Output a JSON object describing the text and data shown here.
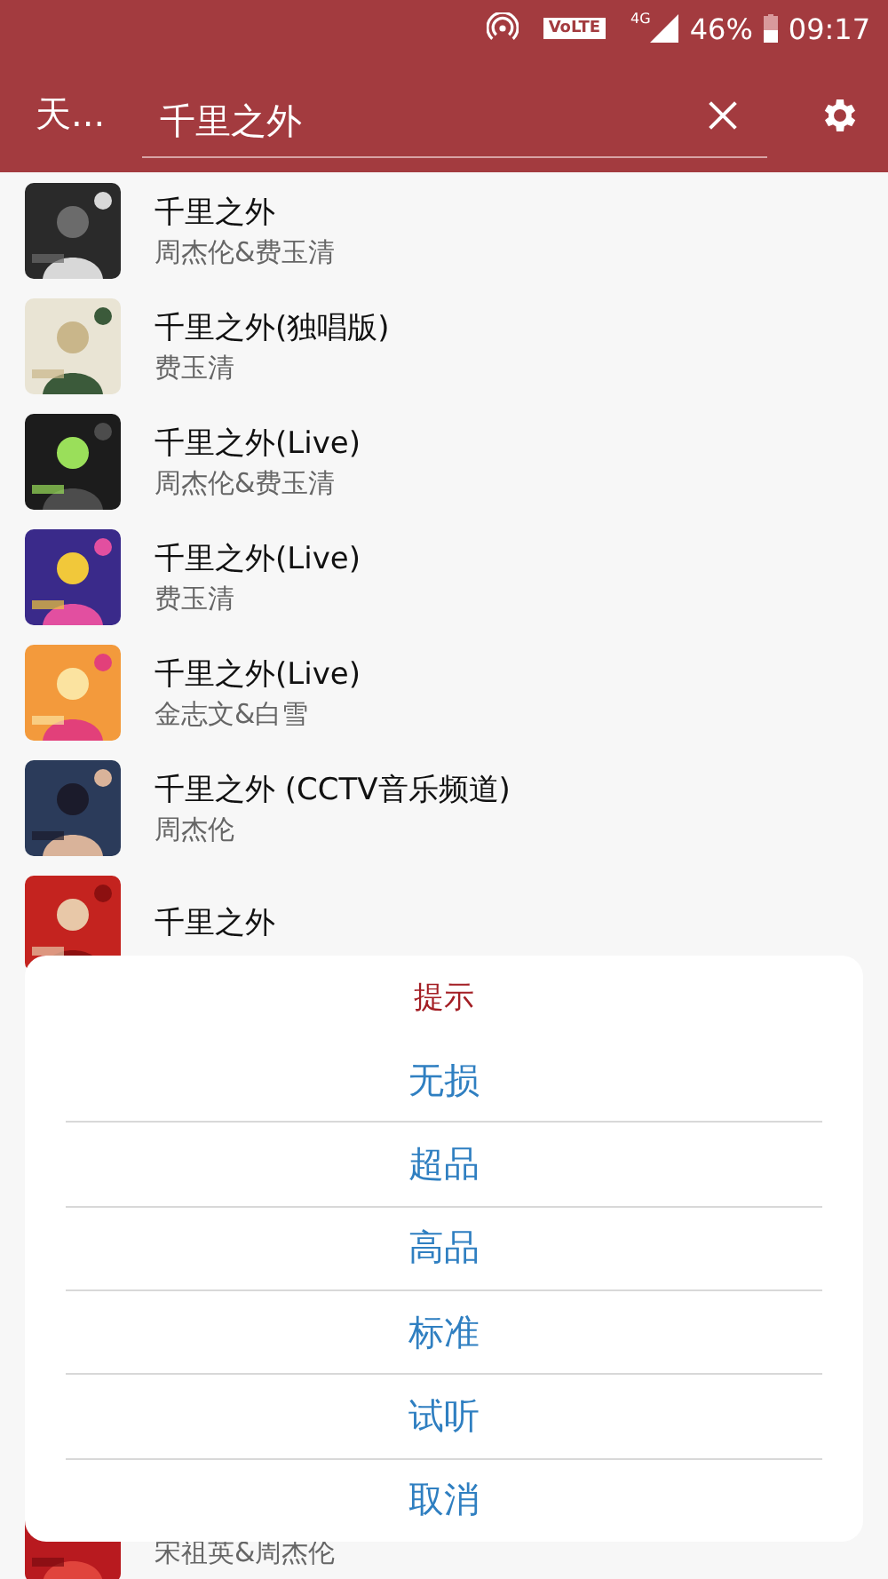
{
  "status_bar": {
    "volte": "VoLTE",
    "network": "4G",
    "battery": "46%",
    "time": "09:17"
  },
  "app_bar": {
    "title": "天...",
    "search": {
      "value": "千里之外"
    }
  },
  "songs": [
    {
      "title": "千里之外",
      "artist": "周杰伦&费玉清"
    },
    {
      "title": "千里之外(独唱版)",
      "artist": "费玉清"
    },
    {
      "title": "千里之外(Live)",
      "artist": "周杰伦&费玉清"
    },
    {
      "title": "千里之外(Live)",
      "artist": "费玉清"
    },
    {
      "title": "千里之外(Live)",
      "artist": "金志文&白雪"
    },
    {
      "title": "千里之外 (CCTV音乐频道)",
      "artist": "周杰伦"
    },
    {
      "title": "千里之外"
    },
    {
      "artist": "宋祖英&周杰伦"
    }
  ],
  "dialog": {
    "title": "提示",
    "options": [
      "无损",
      "超品",
      "高品",
      "标准",
      "试听",
      "取消"
    ]
  }
}
